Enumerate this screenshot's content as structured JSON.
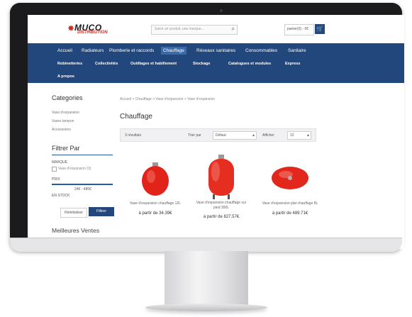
{
  "header": {
    "logo_text": "MUCO",
    "logo_sub": "DISTRIBUTION",
    "search_placeholder": "Saisir un produit, une marque...",
    "cart_label": "panier(0) - 0€"
  },
  "nav": {
    "row1": [
      "Accueil",
      "Radiateurs",
      "Plomberie et raccords",
      "Chauffage",
      "Réseaux sanitaires",
      "Consommables",
      "Sanitaire"
    ],
    "row2": [
      "Robinetteries",
      "Collectivités",
      "Outillages et habillement",
      "Stockage",
      "Catalogues et modules",
      "Express"
    ],
    "row3": [
      "A propos"
    ],
    "active": "Chauffage"
  },
  "sidebar": {
    "categories_title": "Categories",
    "categories": [
      "Vase d'expansion",
      "Vases tampon",
      "Accessoires"
    ],
    "filter_title": "Filtrer Par",
    "filter_brand_label": "MARQUE",
    "filter_brand_option": "Vase d'expansion (3)",
    "filter_price_label": "PRIX",
    "price_range": "24€ - 480€",
    "filter_stock_label": "EN STOCK",
    "reset_label": "Réinitialiser",
    "filter_button": "Filtrer",
    "best_sellers_title": "Meilleures Ventes"
  },
  "main": {
    "breadcrumb": "Accueil > Chauffage > Vase d'expansion > Vase d'expansion",
    "page_title": "Chauffage",
    "view_label": "3 résultats",
    "sort_label": "Trier par",
    "sort_value": "Défaut",
    "per_page_label": "Afficher",
    "per_page_value": "12",
    "products": [
      {
        "name": "Vase d'expansion chauffage 12L",
        "price": "à partir de 34.39€",
        "color": "#e2231a"
      },
      {
        "name": "Vase d'expansion chauffage sur pied 300L",
        "price": "à partir de 827.57€",
        "color": "#e52d20"
      },
      {
        "name": "Vase d'expansion plat chauffage 8L",
        "price": "à partir de 489.71€",
        "color": "#e2281c"
      }
    ]
  }
}
